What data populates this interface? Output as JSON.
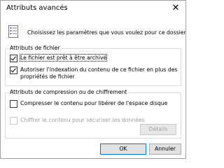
{
  "window": {
    "title": "Attributs avancés",
    "close_glyph": "✕"
  },
  "header": {
    "text": "Choisissez les paramètres que vous voulez pour ce dossier."
  },
  "file_attributes": {
    "legend": "Attributs de fichier",
    "archive": {
      "label": "Le fichier est prêt à être archivé",
      "checked": true
    },
    "indexing": {
      "label": "Autoriser l'indexation du contenu de ce fichier en plus des propriétés de fichier",
      "checked": true
    }
  },
  "compression_encryption": {
    "legend": "Attributs de compression ou de chiffrement",
    "compress": {
      "label": "Compresser le contenu pour libérer de l'espace disque",
      "checked": false
    },
    "encrypt": {
      "label": "Chiffrer le contenu pour sécuriser les données",
      "checked": false,
      "disabled": true
    },
    "details_button": "Détails"
  },
  "buttons": {
    "ok": "OK",
    "cancel": "Annuler"
  }
}
